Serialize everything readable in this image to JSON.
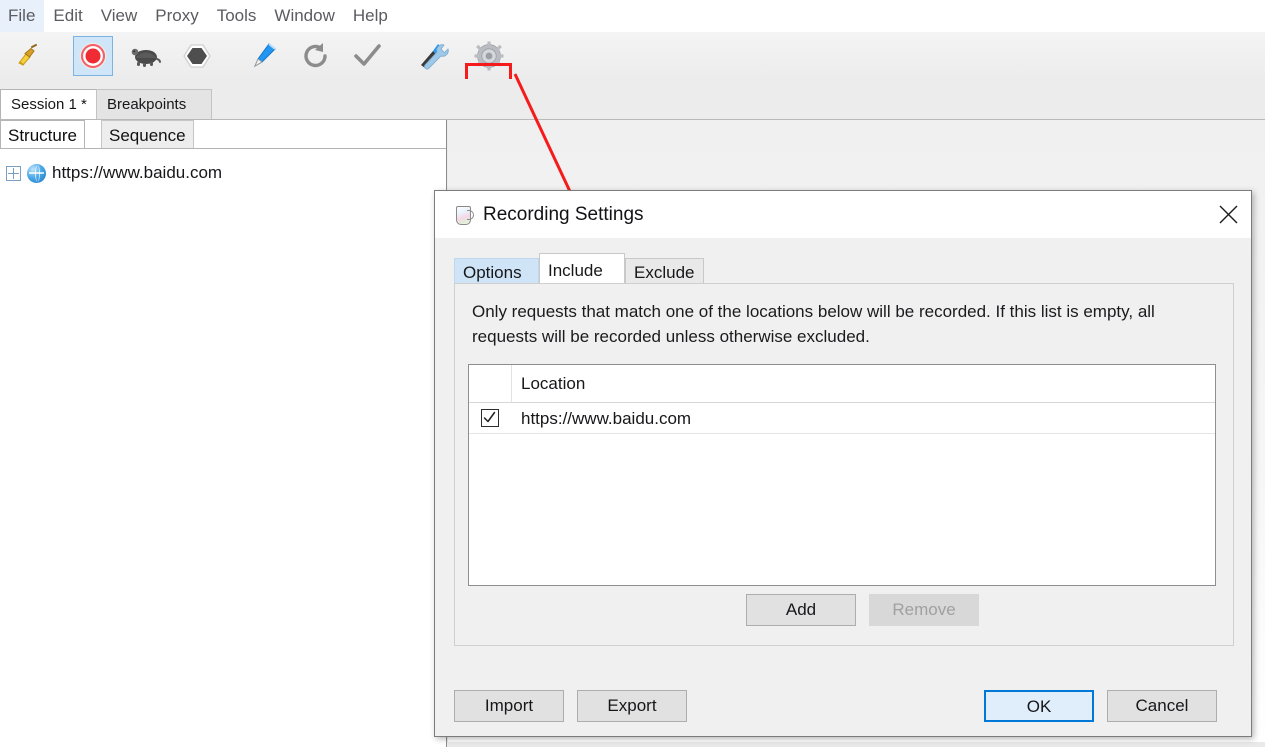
{
  "menubar": {
    "items": [
      "File",
      "Edit",
      "View",
      "Proxy",
      "Tools",
      "Window",
      "Help"
    ]
  },
  "toolbar": {
    "buttons": [
      {
        "name": "clear-session",
        "icon": "broom-icon",
        "label": "Clear"
      },
      {
        "name": "start-stop-recording",
        "icon": "record-icon",
        "label": "Record"
      },
      {
        "name": "throttling",
        "icon": "turtle-icon",
        "label": "Throttling"
      },
      {
        "name": "breakpoints",
        "icon": "hexagon-icon",
        "label": "Breakpoints"
      },
      {
        "name": "compose",
        "icon": "pen-icon",
        "label": "Compose"
      },
      {
        "name": "repeat",
        "icon": "refresh-icon",
        "label": "Repeat"
      },
      {
        "name": "validate",
        "icon": "checkmark-icon",
        "label": "Validate"
      },
      {
        "name": "tools",
        "icon": "wrench-screwdriver-icon",
        "label": "Tools"
      },
      {
        "name": "recording-settings",
        "icon": "gear-icon",
        "label": "Recording Settings"
      }
    ]
  },
  "session_tabs": [
    {
      "label": "Session 1 *",
      "active": true
    },
    {
      "label": "Breakpoints",
      "active": false
    }
  ],
  "left_panel": {
    "tabs": [
      {
        "label": "Structure",
        "active": true
      },
      {
        "label": "Sequence",
        "active": false
      }
    ],
    "tree": [
      {
        "label": "https://www.baidu.com",
        "icon": "globe-icon",
        "expander": "plus"
      }
    ]
  },
  "dialog": {
    "title": "Recording Settings",
    "icon": "charles-jug-icon",
    "close_label": "✕",
    "tabs": [
      {
        "label": "Options",
        "state": "hover"
      },
      {
        "label": "Include",
        "state": "active"
      },
      {
        "label": "Exclude",
        "state": "normal"
      }
    ],
    "description": "Only requests that match one of the locations below will be recorded. If this list is empty, all requests will be recorded unless otherwise excluded.",
    "table": {
      "columns": [
        "",
        "Location"
      ],
      "rows": [
        {
          "checked": true,
          "location": "https://www.baidu.com"
        }
      ]
    },
    "list_buttons": [
      {
        "label": "Add",
        "disabled": false
      },
      {
        "label": "Remove",
        "disabled": true
      }
    ],
    "bottom_buttons": [
      {
        "label": "Import",
        "style": "normal"
      },
      {
        "label": "Export",
        "style": "normal"
      },
      {
        "label": "OK",
        "style": "default"
      },
      {
        "label": "Cancel",
        "style": "normal"
      }
    ]
  },
  "annotation": {
    "arrow_color": "#f61b1b",
    "highlight_color": "#f61b1b",
    "highlight_target": "recording-settings-toolbar-button"
  }
}
